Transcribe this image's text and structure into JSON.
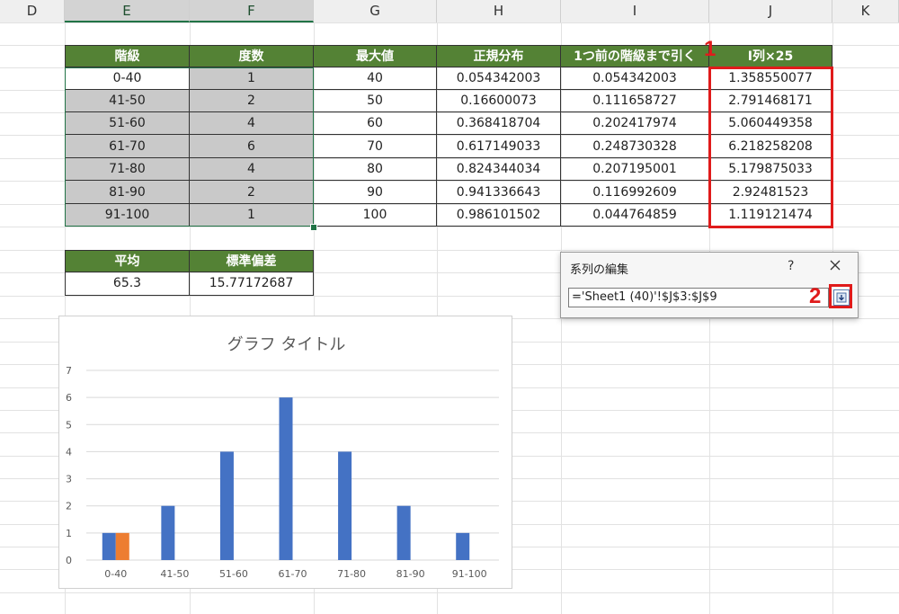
{
  "columns": [
    "D",
    "E",
    "F",
    "G",
    "H",
    "I",
    "J",
    "K"
  ],
  "main_table": {
    "headers": [
      "階級",
      "度数",
      "最大値",
      "正規分布",
      "1つ前の階級まで引く",
      "I列×25"
    ],
    "rows": [
      [
        "0-40",
        "1",
        "40",
        "0.054342003",
        "0.054342003",
        "1.358550077"
      ],
      [
        "41-50",
        "2",
        "50",
        "0.16600073",
        "0.111658727",
        "2.791468171"
      ],
      [
        "51-60",
        "4",
        "60",
        "0.368418704",
        "0.202417974",
        "5.060449358"
      ],
      [
        "61-70",
        "6",
        "70",
        "0.617149033",
        "0.248730328",
        "6.218258208"
      ],
      [
        "71-80",
        "4",
        "80",
        "0.824344034",
        "0.207195001",
        "5.179875033"
      ],
      [
        "81-90",
        "2",
        "90",
        "0.941336643",
        "0.116992609",
        "2.92481523"
      ],
      [
        "91-100",
        "1",
        "100",
        "0.986101502",
        "0.044764859",
        "1.119121474"
      ]
    ]
  },
  "stats_table": {
    "headers": [
      "平均",
      "標準偏差"
    ],
    "values": [
      "65.3",
      "15.77172687"
    ]
  },
  "annotations": {
    "badge1": "1",
    "badge2": "2"
  },
  "dialog": {
    "title": "系列の編集",
    "help": "?",
    "series_values": "='Sheet1 (40)'!$J$3:$J$9"
  },
  "chart_data": {
    "type": "bar",
    "title": "グラフ タイトル",
    "categories": [
      "0-40",
      "41-50",
      "51-60",
      "61-70",
      "71-80",
      "81-90",
      "91-100"
    ],
    "series": [
      {
        "values": [
          1,
          2,
          4,
          6,
          4,
          2,
          1
        ],
        "color": "#4472c4"
      },
      {
        "values": [
          1,
          null,
          null,
          null,
          null,
          null,
          null
        ],
        "color": "#ed7d31"
      }
    ],
    "ylim": [
      0,
      7
    ],
    "yticks": [
      "0",
      "1",
      "2",
      "3",
      "4",
      "5",
      "6",
      "7"
    ],
    "grid": true
  },
  "colors": {
    "header_green": "#548235",
    "accent_red": "#e01b1b",
    "selection_green": "#217346"
  }
}
